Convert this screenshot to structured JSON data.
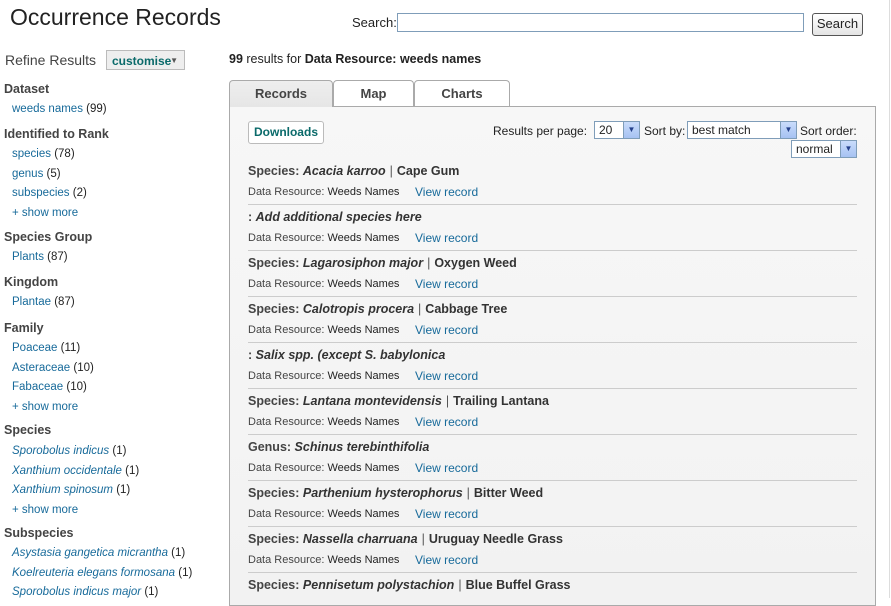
{
  "header": {
    "title": "Occurrence Records",
    "search_label": "Search:",
    "search_value": "",
    "search_button": "Search"
  },
  "sidebar": {
    "refine_label": "Refine Results",
    "customise_label": "customise",
    "facets": [
      {
        "title": "Dataset",
        "items": [
          {
            "label": "weeds names",
            "count": "(99)",
            "italic": false
          }
        ],
        "show_more": ""
      },
      {
        "title": "Identified to Rank",
        "items": [
          {
            "label": "species",
            "count": "(78)",
            "italic": false
          },
          {
            "label": "genus",
            "count": "(5)",
            "italic": false
          },
          {
            "label": "subspecies",
            "count": "(2)",
            "italic": false
          }
        ],
        "show_more": "+ show more"
      },
      {
        "title": "Species Group",
        "items": [
          {
            "label": "Plants",
            "count": "(87)",
            "italic": false
          }
        ],
        "show_more": ""
      },
      {
        "title": "Kingdom",
        "items": [
          {
            "label": "Plantae",
            "count": "(87)",
            "italic": false
          }
        ],
        "show_more": ""
      },
      {
        "title": "Family",
        "items": [
          {
            "label": "Poaceae",
            "count": "(11)",
            "italic": false
          },
          {
            "label": "Asteraceae",
            "count": "(10)",
            "italic": false
          },
          {
            "label": "Fabaceae",
            "count": "(10)",
            "italic": false
          }
        ],
        "show_more": "+ show more"
      },
      {
        "title": "Species",
        "items": [
          {
            "label": "Sporobolus indicus",
            "count": "(1)",
            "italic": true
          },
          {
            "label": "Xanthium occidentale",
            "count": "(1)",
            "italic": true
          },
          {
            "label": "Xanthium spinosum",
            "count": "(1)",
            "italic": true
          }
        ],
        "show_more": "+ show more"
      },
      {
        "title": "Subspecies",
        "items": [
          {
            "label": "Asystasia gangetica micrantha",
            "count": "(1)",
            "italic": true
          },
          {
            "label": "Koelreuteria elegans formosana",
            "count": "(1)",
            "italic": true
          },
          {
            "label": "Sporobolus indicus major",
            "count": "(1)",
            "italic": true
          }
        ],
        "show_more": ""
      }
    ]
  },
  "results": {
    "count": "99",
    "count_text": "results for",
    "query": "Data Resource: weeds names"
  },
  "tabs": [
    {
      "label": "Records",
      "active": true
    },
    {
      "label": "Map",
      "active": false
    },
    {
      "label": "Charts",
      "active": false
    }
  ],
  "toolbar": {
    "downloads_label": "Downloads",
    "per_page_label": "Results per page:",
    "per_page_value": "20",
    "sort_by_label": "Sort by:",
    "sort_by_value": "best match",
    "sort_order_label": "Sort order:",
    "sort_order_value": "normal"
  },
  "records": [
    {
      "rank": "Species:",
      "scientific": "Acacia karroo",
      "common": "Cape Gum",
      "dr_label": "Data Resource:",
      "dr_name": "Weeds Names",
      "view": "View record"
    },
    {
      "rank": ":",
      "scientific": "Add additional species here",
      "common": "",
      "dr_label": "Data Resource:",
      "dr_name": "Weeds Names",
      "view": "View record"
    },
    {
      "rank": "Species:",
      "scientific": "Lagarosiphon major",
      "common": "Oxygen Weed",
      "dr_label": "Data Resource:",
      "dr_name": "Weeds Names",
      "view": "View record"
    },
    {
      "rank": "Species:",
      "scientific": "Calotropis procera",
      "common": "Cabbage Tree",
      "dr_label": "Data Resource:",
      "dr_name": "Weeds Names",
      "view": "View record"
    },
    {
      "rank": ":",
      "scientific": "Salix spp. (except S. babylonica",
      "common": "",
      "dr_label": "Data Resource:",
      "dr_name": "Weeds Names",
      "view": "View record"
    },
    {
      "rank": "Species:",
      "scientific": "Lantana montevidensis",
      "common": "Trailing Lantana",
      "dr_label": "Data Resource:",
      "dr_name": "Weeds Names",
      "view": "View record"
    },
    {
      "rank": "Genus:",
      "scientific": "Schinus terebinthifolia",
      "common": "",
      "dr_label": "Data Resource:",
      "dr_name": "Weeds Names",
      "view": "View record"
    },
    {
      "rank": "Species:",
      "scientific": "Parthenium hysterophorus",
      "common": "Bitter Weed",
      "dr_label": "Data Resource:",
      "dr_name": "Weeds Names",
      "view": "View record"
    },
    {
      "rank": "Species:",
      "scientific": "Nassella charruana",
      "common": "Uruguay Needle Grass",
      "dr_label": "Data Resource:",
      "dr_name": "Weeds Names",
      "view": "View record"
    },
    {
      "rank": "Species:",
      "scientific": "Pennisetum polystachion",
      "common": "Blue Buffel Grass",
      "dr_label": "",
      "dr_name": "",
      "view": ""
    }
  ],
  "colors": {
    "link": "#176a9a",
    "accent": "#0a6a6a",
    "border": "#aaaaaa"
  }
}
